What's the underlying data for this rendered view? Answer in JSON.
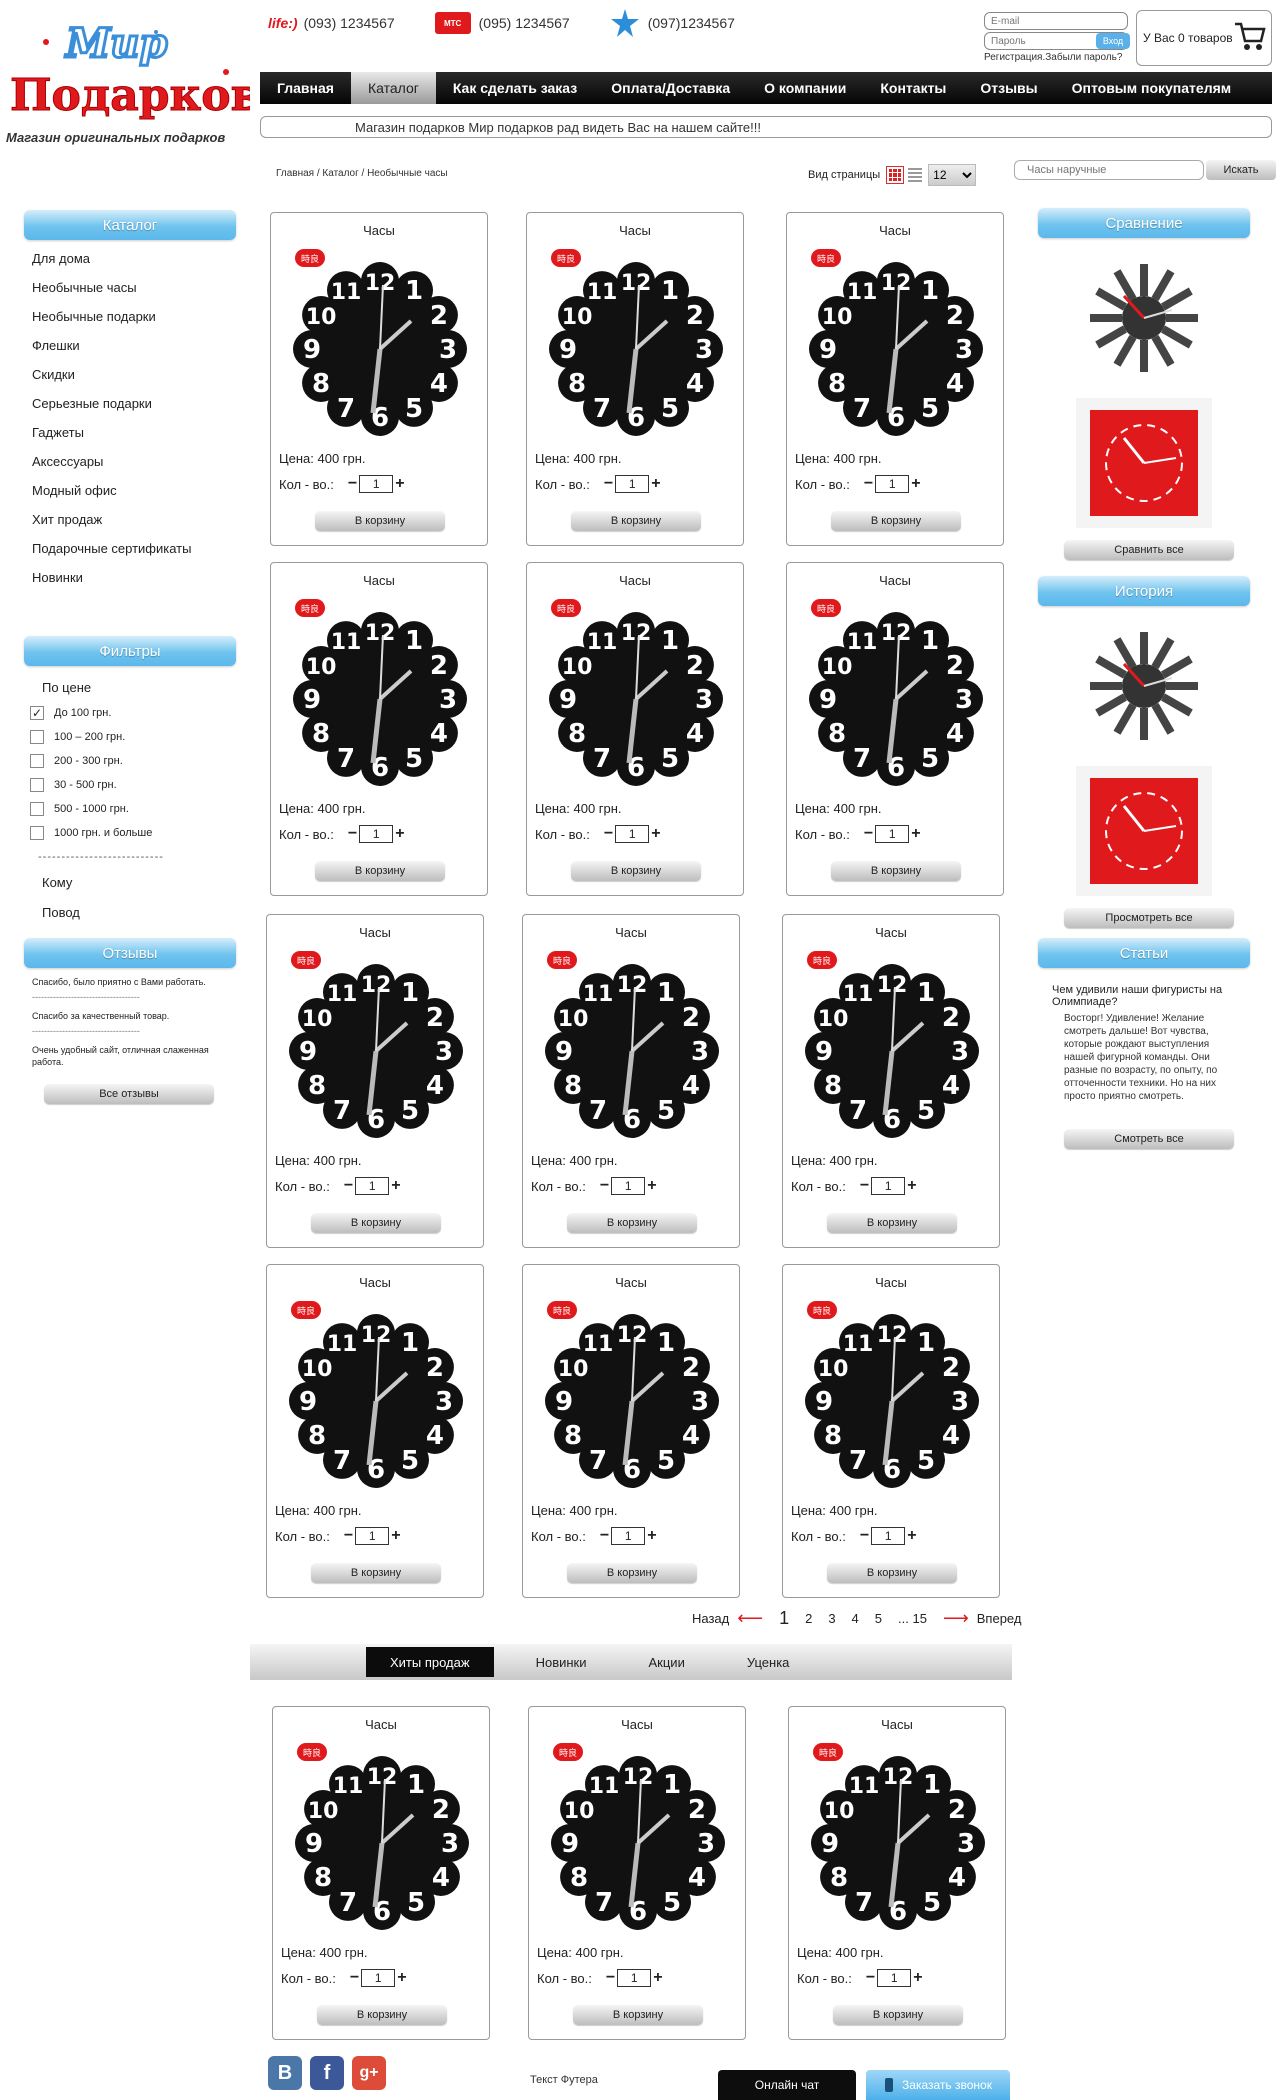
{
  "logo": {
    "line1": "Мир",
    "line2": "Подарков",
    "tagline": "Магазин оригинальных подарков"
  },
  "phones": [
    {
      "operator": "life:)",
      "number": "(093) 1234567"
    },
    {
      "operator": "МТС",
      "number": "(095) 1234567"
    },
    {
      "operator": "Kyivstar",
      "number": "(097)1234567"
    }
  ],
  "login": {
    "email_placeholder": "E-mail",
    "password_placeholder": "Пароль",
    "enter_label": "Вход",
    "links": "Регистрация.Забыли пароль?"
  },
  "cart": {
    "text": "У Вас 0 товаров"
  },
  "nav": [
    "Главная",
    "Каталог",
    "Как сделать заказ",
    "Оплата/Доставка",
    "О компании",
    "Контакты",
    "Отзывы",
    "Оптовым покупателям"
  ],
  "welcome": "Магазин подарков Мир подарков рад видеть Вас на нашем сайте!!!",
  "breadcrumb": "Главная / Каталог / Необычные часы",
  "view": {
    "label": "Вид страницы",
    "per_page": "12"
  },
  "search": {
    "placeholder": "Часы наручные",
    "button": "Искать"
  },
  "catalog": {
    "title": "Каталог",
    "items": [
      "Для дома",
      "Необычные часы",
      "Необычные подарки",
      "Флешки",
      "Скидки",
      "Серьезные подарки",
      "Гаджеты",
      "Аксессуары",
      "Модный офис",
      "Хит продаж",
      "Подарочные сертификаты",
      "Новинки"
    ]
  },
  "filters": {
    "title": "Фильтры",
    "price_label": "По цене",
    "options": [
      {
        "label": "До 100 грн.",
        "checked": true
      },
      {
        "label": "100 – 200 грн.",
        "checked": false
      },
      {
        "label": "200 - 300 грн.",
        "checked": false
      },
      {
        "label": "30 - 500 грн.",
        "checked": false
      },
      {
        "label": "500 - 1000 грн.",
        "checked": false
      },
      {
        "label": "1000 грн. и больше",
        "checked": false
      }
    ],
    "separator": "---------------------------",
    "for_whom": "Кому",
    "occasion": "Повод"
  },
  "reviews": {
    "title": "Отзывы",
    "items": [
      "Спасибо, было приятно с Вами работать.",
      "Спасибо за качественный товар.",
      "Очень удобный сайт, отличная слаженная работа."
    ],
    "separator": "------------------------------------",
    "all_button": "Все отзывы"
  },
  "compare": {
    "title": "Сравнение",
    "button": "Сравнить все"
  },
  "history": {
    "title": "История",
    "button": "Просмотреть все"
  },
  "articles": {
    "title": "Статьи",
    "headline": "Чем удивили наши фигуристы на Олимпиаде?",
    "text": "Восторг! Удивление! Желание смотреть дальше! Вот чувства, которые рождают выступления нашей фигурной команды. Они разные по возрасту, по опыту, по отточенности техники. Но на них просто приятно смотреть.",
    "button": "Смотреть все"
  },
  "product": {
    "title": "Часы",
    "price": "Цена: 400 грн.",
    "qty_label": "Кол - во.:",
    "qty_value": "1",
    "buy": "В корзину"
  },
  "pager": {
    "prev": "Назад",
    "pages": [
      "1",
      "2",
      "3",
      "4",
      "5",
      "... 15"
    ],
    "next": "Вперед"
  },
  "bottom_tabs": [
    "Хиты продаж",
    "Новинки",
    "Акции",
    "Уценка"
  ],
  "footer": {
    "text": "Текст Футера",
    "chat": "Онлайн чат",
    "callback": "Заказать звонок"
  },
  "colors": {
    "accent_red": "#e0191d",
    "panel_blue": "#5cb8ec",
    "nav_black": "#0a0a0a"
  }
}
